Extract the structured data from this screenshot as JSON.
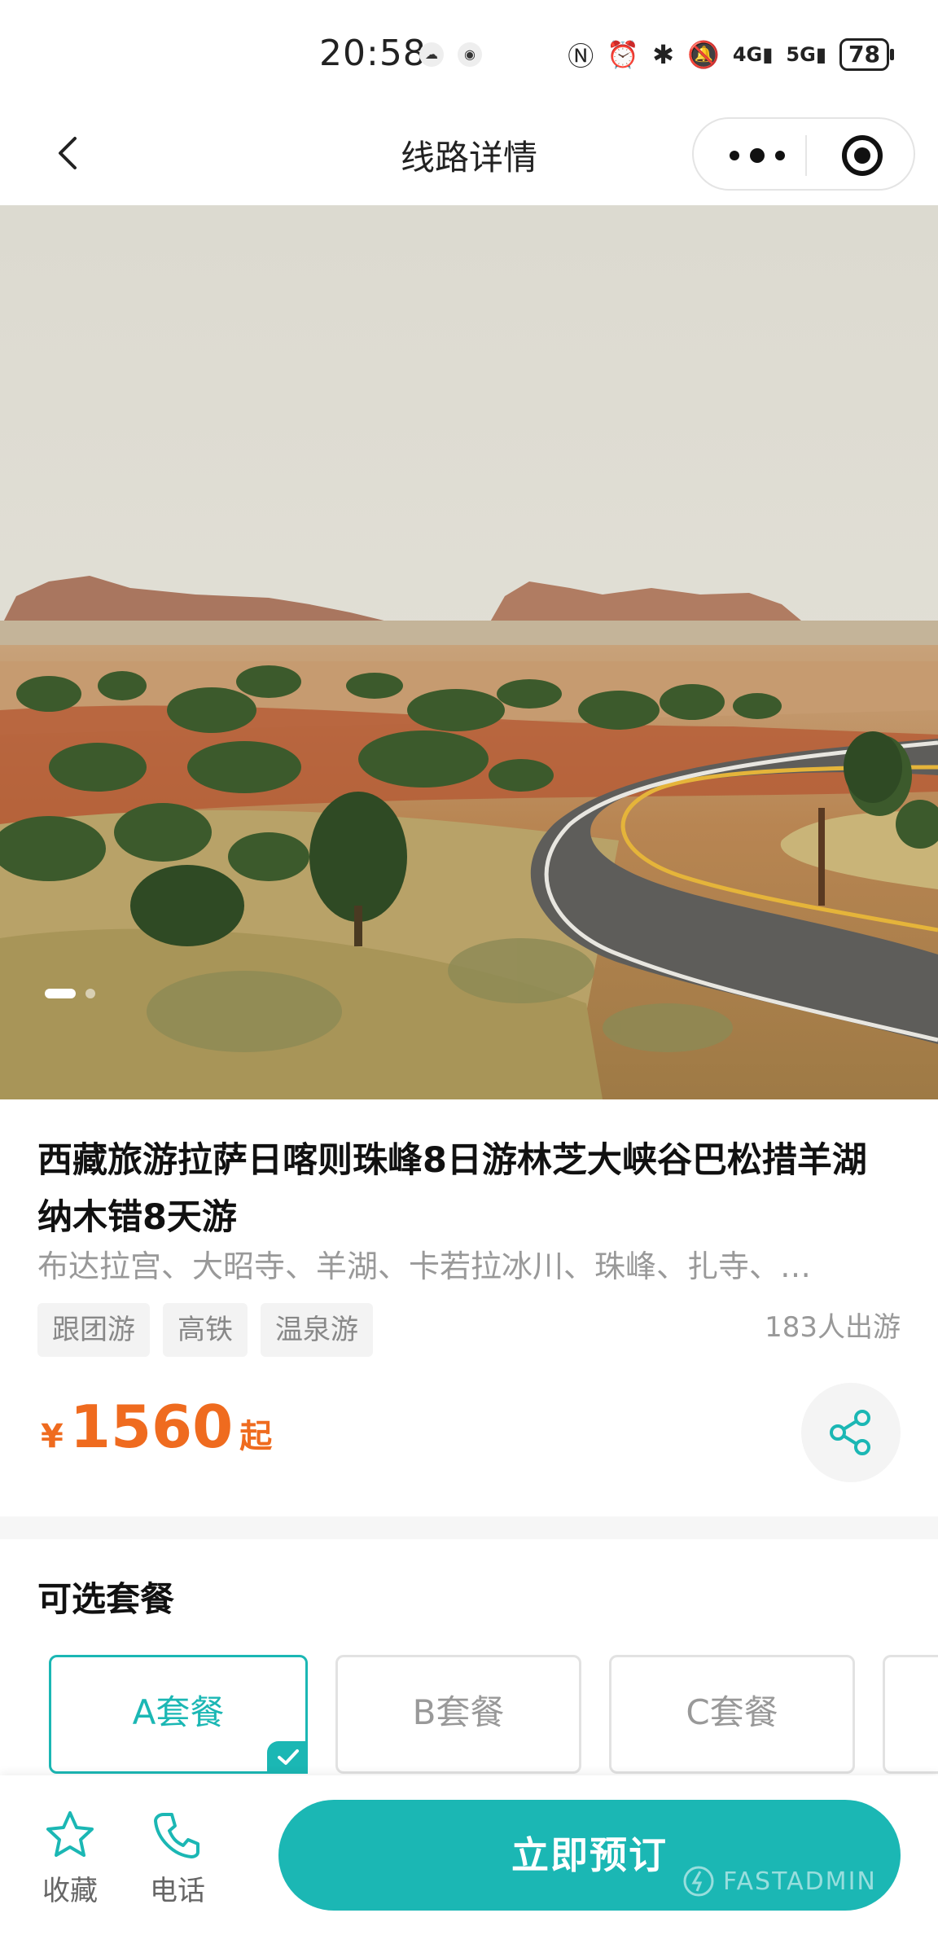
{
  "status_bar": {
    "time": "20:58",
    "icons": [
      "nfc-icon",
      "alarm-icon",
      "bluetooth-icon",
      "mute-icon",
      "4g-signal-icon",
      "5g-signal-icon"
    ],
    "battery": "78"
  },
  "nav": {
    "title": "线路详情"
  },
  "hero": {
    "slide_count": 2,
    "active_slide": 1
  },
  "product": {
    "title": "西藏旅游拉萨日喀则珠峰8日游林芝大峡谷巴松措羊湖纳木错8天游",
    "subtitle": "布达拉宫、大昭寺、羊湖、卡若拉冰川、珠峰、扎寺、…",
    "tags": [
      "跟团游",
      "高铁",
      "温泉游"
    ],
    "travelers": "183人出游",
    "price_symbol": "¥",
    "price": "1560",
    "price_suffix": "起"
  },
  "packages": {
    "title": "可选套餐",
    "items": [
      "A套餐",
      "B套餐",
      "C套餐"
    ],
    "selected": "A套餐"
  },
  "bottom_bar": {
    "favorite_label": "收藏",
    "phone_label": "电话",
    "book_label": "立即预订",
    "watermark": "FASTADMIN"
  },
  "colors": {
    "accent": "#1bb7b4",
    "price": "#ef6b1f"
  }
}
